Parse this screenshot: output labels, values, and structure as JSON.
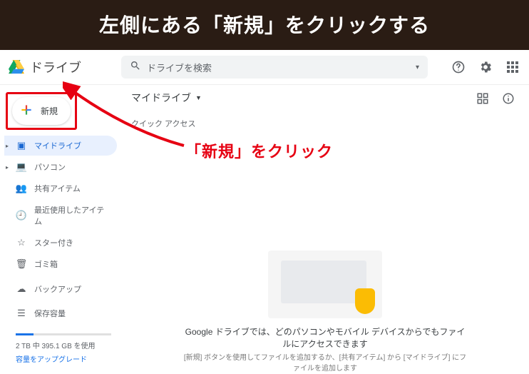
{
  "banner": "左側にある「新規」をクリックする",
  "callout": "「新規」をクリック",
  "logo_text": "ドライブ",
  "search": {
    "placeholder": "ドライブを検索"
  },
  "new_button_label": "新規",
  "breadcrumb": {
    "label": "マイドライブ"
  },
  "quick_access_label": "クイック アクセス",
  "sidebar": {
    "items": [
      {
        "label": "マイドライブ",
        "active": true
      },
      {
        "label": "パソコン"
      },
      {
        "label": "共有アイテム"
      },
      {
        "label": "最近使用したアイテム"
      },
      {
        "label": "スター付き"
      },
      {
        "label": "ゴミ箱"
      }
    ],
    "backup_label": "バックアップ",
    "storage_label": "保存容量",
    "storage_text": "2 TB 中 395.1 GB を使用",
    "storage_link": "容量をアップグレード"
  },
  "empty": {
    "p1": "Google ドライブでは、どのパソコンやモバイル デバイスからでもファイルにアクセスできます",
    "p2": "[新規] ボタンを使用してファイルを追加するか、[共有アイテム] から [マイドライブ] にファイルを追加します"
  }
}
